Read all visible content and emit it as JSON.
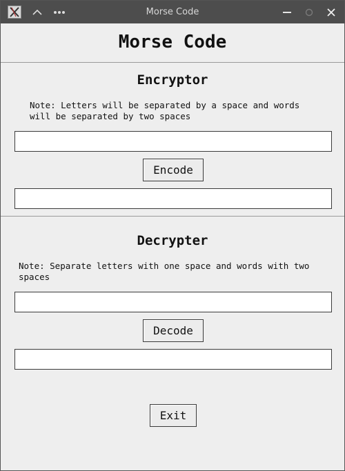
{
  "window": {
    "title": "Morse Code",
    "icons": [
      "app-icon",
      "chevron-up-icon",
      "more-icon",
      "minimize-icon",
      "maximize-icon",
      "close-icon"
    ]
  },
  "header": {
    "title": "Morse Code"
  },
  "encryptor": {
    "title": "Encryptor",
    "note": "Note: Letters will be separated by a space and words\nwill be separated by two spaces",
    "input_value": "",
    "button_label": "Encode",
    "output_value": ""
  },
  "decrypter": {
    "title": "Decrypter",
    "note": "Note: Separate letters with one space and words with two\nspaces",
    "input_value": "",
    "button_label": "Decode",
    "output_value": ""
  },
  "footer": {
    "exit_label": "Exit"
  }
}
